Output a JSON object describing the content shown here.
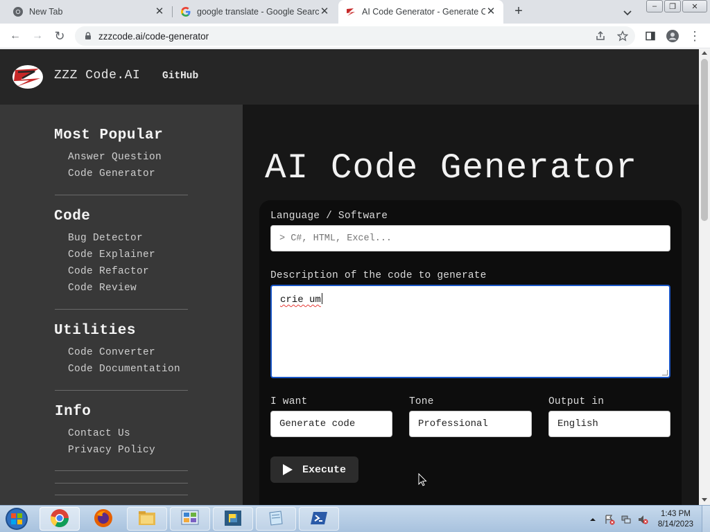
{
  "browser": {
    "tabs": [
      {
        "label": "New Tab",
        "icon": "chrome-icon",
        "active": false
      },
      {
        "label": "google translate - Google Search",
        "icon": "google-icon",
        "active": false
      },
      {
        "label": "AI Code Generator - Generate Co",
        "icon": "zzzcode-icon",
        "active": true
      }
    ],
    "new_tab": "+",
    "close": "✕",
    "window": {
      "minimize": "–",
      "maximize": "❐",
      "close": "✕"
    },
    "toolbar": {
      "back": "←",
      "forward": "→",
      "reload": "↻",
      "menu": "⋮"
    },
    "url": "zzzcode.ai/code-generator"
  },
  "site": {
    "brand": "ZZZ Code.AI",
    "github": "GitHub"
  },
  "sidebar": {
    "sections": [
      {
        "title": "Most Popular",
        "links": [
          "Answer Question",
          "Code Generator"
        ]
      },
      {
        "title": "Code",
        "links": [
          "Bug Detector",
          "Code Explainer",
          "Code Refactor",
          "Code Review"
        ]
      },
      {
        "title": "Utilities",
        "links": [
          "Code Converter",
          "Code Documentation"
        ]
      },
      {
        "title": "Info",
        "links": [
          "Contact Us",
          "Privacy Policy"
        ]
      }
    ]
  },
  "main": {
    "title": "AI Code Generator",
    "language_label": "Language / Software",
    "language_placeholder": "> C#, HTML, Excel...",
    "description_label": "Description of the code to generate",
    "description_value": "crie um",
    "i_want_label": "I want",
    "i_want_value": "Generate code",
    "tone_label": "Tone",
    "tone_value": "Professional",
    "output_label": "Output in",
    "output_value": "English",
    "execute_label": "Execute"
  },
  "taskbar": {
    "apps": [
      "chrome-icon",
      "firefox-icon",
      "explorer-icon",
      "control-panel-icon",
      "python-icon",
      "notepad-icon",
      "powershell-icon"
    ],
    "time": "1:43 PM",
    "date": "8/14/2023"
  },
  "colors": {
    "page_bg": "#171717",
    "header_bg": "#262626",
    "sidebar_bg": "#383838",
    "card_bg": "#0d0d0d",
    "focus_border": "#1a56c6"
  }
}
